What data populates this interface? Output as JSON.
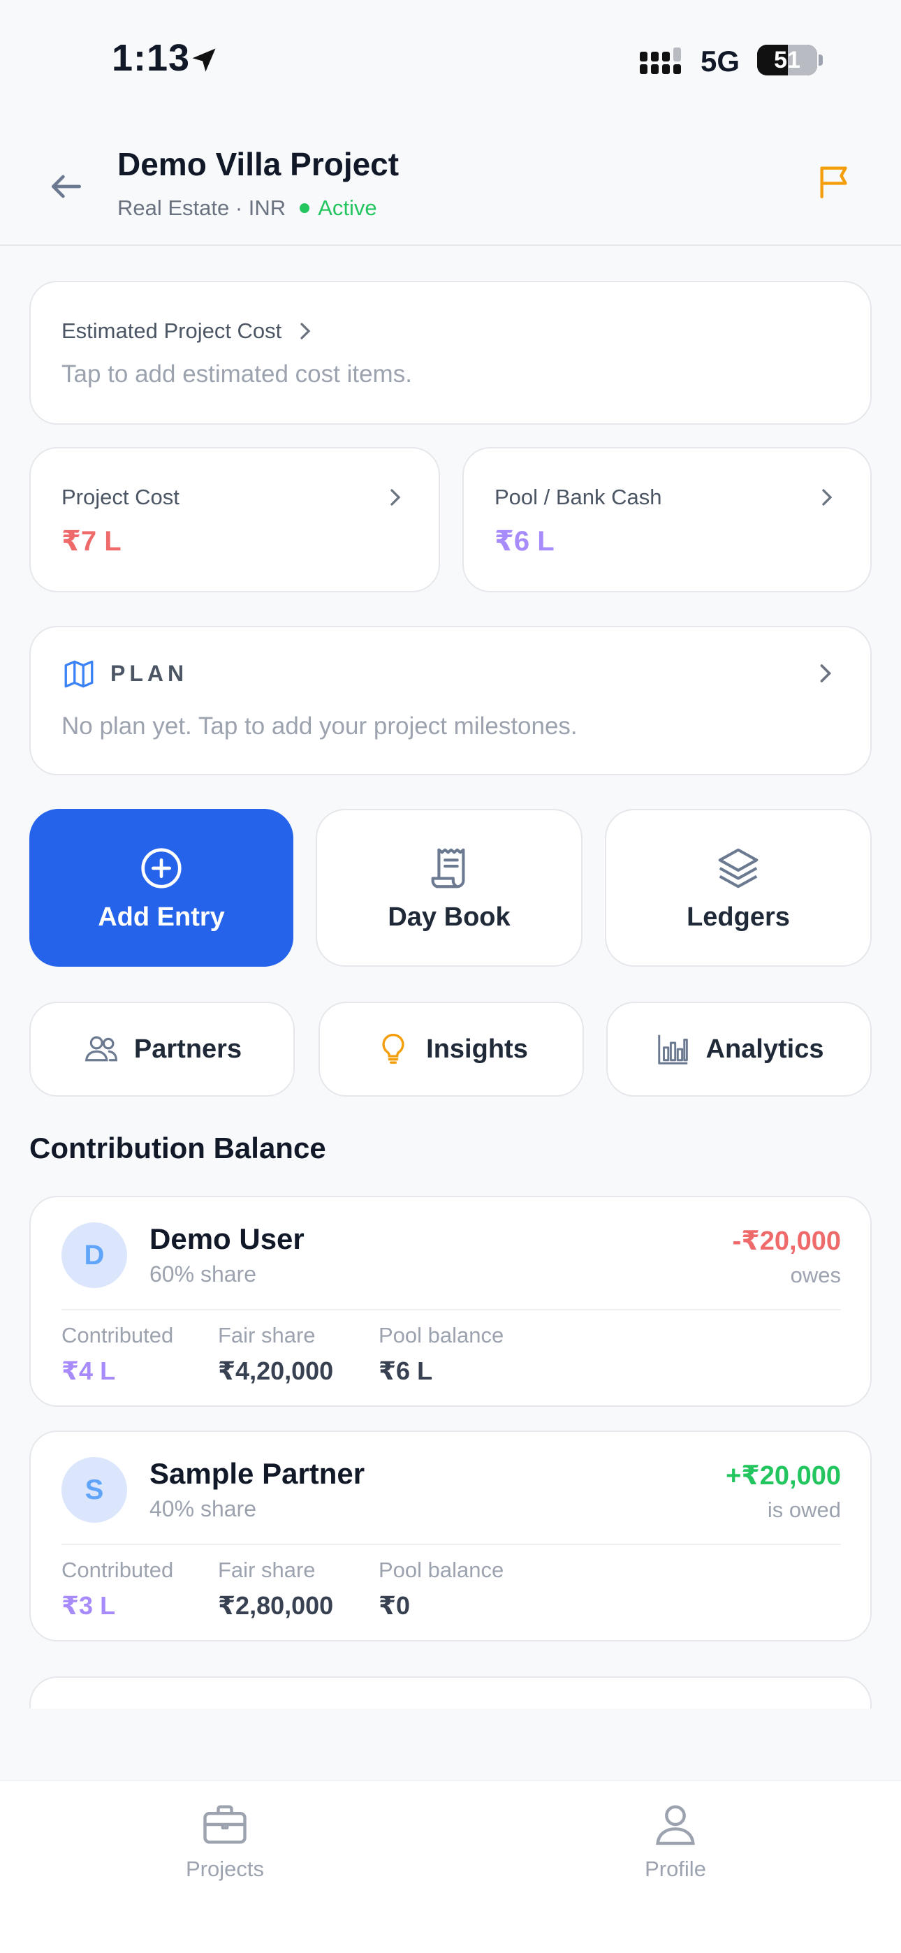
{
  "status_bar": {
    "time": "1:13",
    "network": "5G",
    "battery": "51"
  },
  "header": {
    "title": "Demo Villa Project",
    "category": "Real Estate · INR",
    "status": "Active"
  },
  "estimated_cost": {
    "label": "Estimated Project Cost",
    "hint": "Tap to add estimated cost items."
  },
  "project_cost": {
    "label": "Project Cost",
    "value": "₹7 L"
  },
  "pool_cash": {
    "label": "Pool / Bank Cash",
    "value": "₹6 L"
  },
  "plan": {
    "label": "PLAN",
    "hint": "No plan yet. Tap to add your project milestones."
  },
  "actions": {
    "add_entry": "Add Entry",
    "day_book": "Day Book",
    "ledgers": "Ledgers",
    "partners": "Partners",
    "insights": "Insights",
    "analytics": "Analytics"
  },
  "contribution": {
    "title": "Contribution Balance",
    "stat_labels": {
      "contributed": "Contributed",
      "fair_share": "Fair share",
      "pool_balance": "Pool balance"
    },
    "partners": [
      {
        "initial": "D",
        "name": "Demo User",
        "share": "60% share",
        "balance": "-₹20,000",
        "balance_note": "owes",
        "contributed": "₹4 L",
        "fair_share": "₹4,20,000",
        "pool_balance": "₹6 L"
      },
      {
        "initial": "S",
        "name": "Sample Partner",
        "share": "40% share",
        "balance": "+₹20,000",
        "balance_note": "is owed",
        "contributed": "₹3 L",
        "fair_share": "₹2,80,000",
        "pool_balance": "₹0"
      }
    ]
  },
  "tabbar": {
    "projects": "Projects",
    "profile": "Profile"
  },
  "colors": {
    "primary": "#2563EB",
    "negative": "#EF6B6B",
    "positive": "#22C55E",
    "purple": "#A78BFA",
    "accent_flag": "#F59E0B"
  },
  "icons": [
    "location-arrow-icon",
    "signal-icon",
    "back-arrow-icon",
    "flag-icon",
    "chevron-right-icon",
    "map-icon",
    "plus-circle-icon",
    "receipt-icon",
    "layers-icon",
    "users-icon",
    "lightbulb-icon",
    "bar-chart-icon",
    "briefcase-icon",
    "user-icon"
  ]
}
